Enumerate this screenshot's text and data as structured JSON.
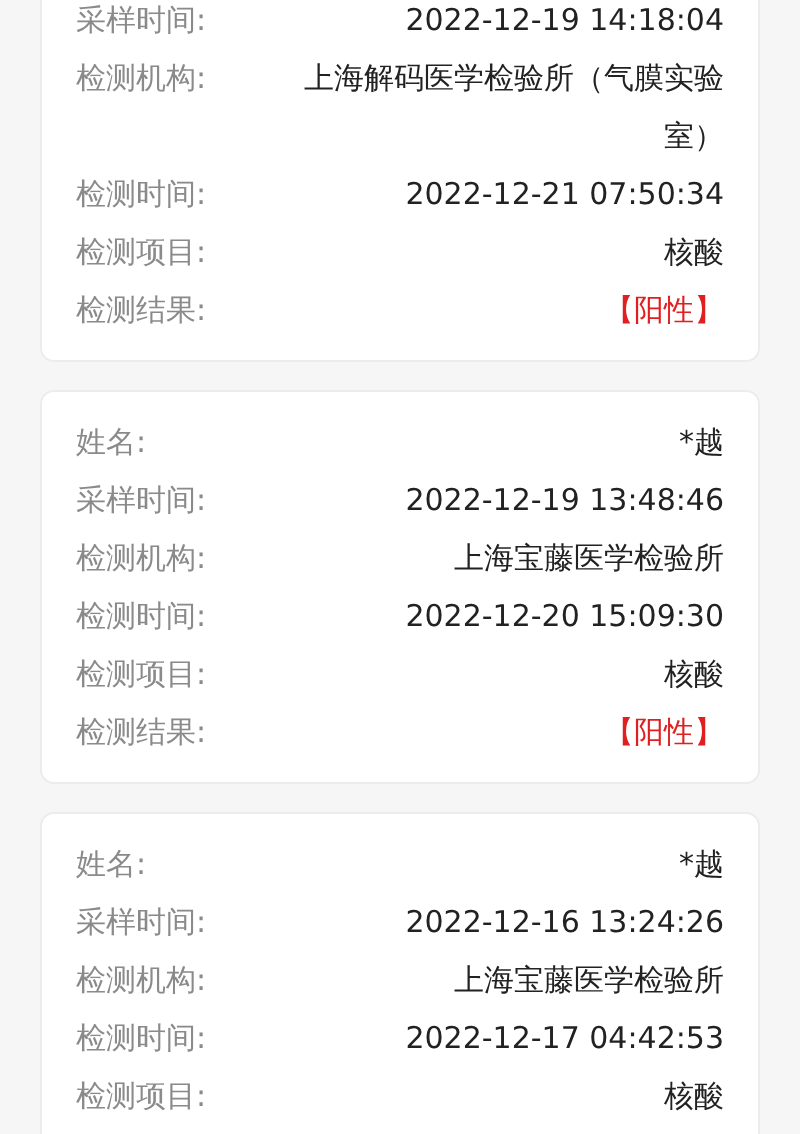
{
  "records": [
    {
      "rows": [
        {
          "kind": "text",
          "label": "采样时间:",
          "value": "2022-12-19 14:18:04"
        },
        {
          "kind": "text",
          "label": "检测机构:",
          "value": "上海解码医学检验所（气膜实验室）"
        },
        {
          "kind": "text",
          "label": "检测时间:",
          "value": "2022-12-21 07:50:34"
        },
        {
          "kind": "text",
          "label": "检测项目:",
          "value": "核酸"
        },
        {
          "kind": "result",
          "label": "检测结果:",
          "value": "【阳性】"
        }
      ]
    },
    {
      "rows": [
        {
          "kind": "text",
          "label": "姓名:",
          "value": "*越"
        },
        {
          "kind": "text",
          "label": "采样时间:",
          "value": "2022-12-19 13:48:46"
        },
        {
          "kind": "text",
          "label": "检测机构:",
          "value": "上海宝藤医学检验所"
        },
        {
          "kind": "text",
          "label": "检测时间:",
          "value": "2022-12-20 15:09:30"
        },
        {
          "kind": "text",
          "label": "检测项目:",
          "value": "核酸"
        },
        {
          "kind": "result",
          "label": "检测结果:",
          "value": "【阳性】"
        }
      ]
    },
    {
      "rows": [
        {
          "kind": "text",
          "label": "姓名:",
          "value": "*越"
        },
        {
          "kind": "text",
          "label": "采样时间:",
          "value": "2022-12-16 13:24:26"
        },
        {
          "kind": "text",
          "label": "检测机构:",
          "value": "上海宝藤医学检验所"
        },
        {
          "kind": "text",
          "label": "检测时间:",
          "value": "2022-12-17 04:42:53"
        },
        {
          "kind": "text",
          "label": "检测项目:",
          "value": "核酸"
        }
      ]
    }
  ]
}
